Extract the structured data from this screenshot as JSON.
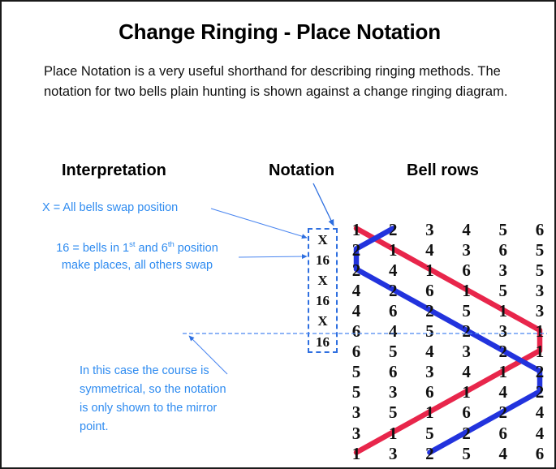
{
  "slide": {
    "title": "Change Ringing  - Place Notation",
    "intro": "Place Notation is a very useful shorthand for describing ringing methods. The notation for two bells plain hunting is shown against a change ringing diagram.",
    "border_color": "#1a1a1a",
    "background": "#ffffff"
  },
  "headings": {
    "interpretation": "Interpretation",
    "notation": "Notation",
    "bell_rows": "Bell rows"
  },
  "annotations": {
    "accent_color": "#2e8bf0",
    "x_rule": "X = All bells swap position",
    "sixteen_rule_line1_pre": "16 = bells in 1",
    "sixteen_rule_line1_sup1": "st",
    "sixteen_rule_line1_mid": " and 6",
    "sixteen_rule_line1_sup2": "th",
    "sixteen_rule_line1_post": " position",
    "sixteen_rule_line2": "make places, all others swap",
    "mirror_note": "In this case the course is symmetrical, so the notation is only shown to the mirror point."
  },
  "notation": {
    "items": [
      "X",
      "16",
      "X",
      "16",
      "X",
      "16"
    ],
    "box_border_color": "#2e6fe0"
  },
  "chart_data": {
    "type": "table",
    "title": "Bell rows",
    "categories": [
      "1",
      "2",
      "3",
      "4",
      "5",
      "6"
    ],
    "rows": [
      [
        1,
        2,
        3,
        4,
        5,
        6
      ],
      [
        2,
        1,
        4,
        3,
        6,
        5
      ],
      [
        2,
        4,
        1,
        6,
        3,
        5
      ],
      [
        4,
        2,
        6,
        1,
        5,
        3
      ],
      [
        4,
        6,
        2,
        5,
        1,
        3
      ],
      [
        6,
        4,
        5,
        2,
        3,
        1
      ],
      [
        6,
        5,
        4,
        3,
        2,
        1
      ],
      [
        5,
        6,
        3,
        4,
        1,
        2
      ],
      [
        5,
        3,
        6,
        1,
        4,
        2
      ],
      [
        3,
        5,
        1,
        6,
        2,
        4
      ],
      [
        3,
        1,
        5,
        2,
        6,
        4
      ],
      [
        1,
        3,
        2,
        5,
        4,
        6
      ]
    ],
    "series": [
      {
        "name": "bell-1-path",
        "color": "#e8264b",
        "positions": [
          1,
          2,
          3,
          4,
          5,
          6,
          6,
          5,
          4,
          3,
          2,
          1
        ]
      },
      {
        "name": "bell-2-path",
        "color": "#2233dd",
        "positions": [
          2,
          1,
          1,
          2,
          3,
          4,
          5,
          6,
          6,
          5,
          4,
          3
        ]
      }
    ],
    "mirror_line": {
      "after_row": 6,
      "style": "dashed",
      "color": "#4a86f0"
    },
    "grid": false,
    "legend": "none"
  }
}
